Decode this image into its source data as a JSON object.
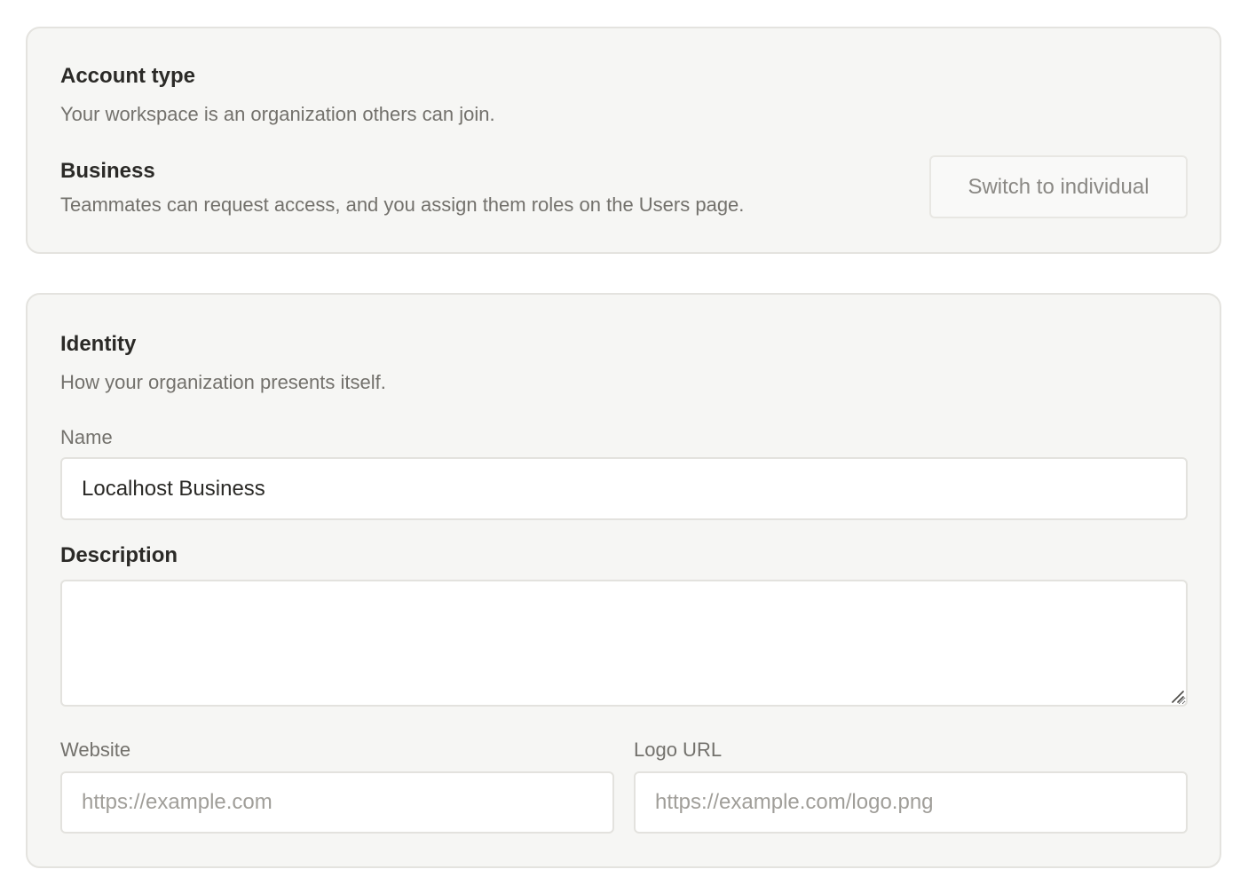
{
  "account_type": {
    "title": "Account type",
    "subtitle": "Your workspace is an organization others can join.",
    "current_type": "Business",
    "current_type_description": "Teammates can request access, and you assign them roles on the Users page.",
    "switch_button_label": "Switch to individual"
  },
  "identity": {
    "title": "Identity",
    "subtitle": "How your organization presents itself.",
    "name": {
      "label": "Name",
      "value": "Localhost Business"
    },
    "description": {
      "label": "Description",
      "value": "",
      "resize_icon": "resize-grip-icon"
    },
    "website": {
      "label": "Website",
      "value": "",
      "placeholder": "https://example.com"
    },
    "logo_url": {
      "label": "Logo URL",
      "value": "",
      "placeholder": "https://example.com/logo.png"
    }
  },
  "colors": {
    "card_background": "#f6f6f4",
    "card_border": "#e4e3df",
    "text_primary": "#2b2a27",
    "text_secondary": "#73716c",
    "placeholder": "#a09e99"
  }
}
